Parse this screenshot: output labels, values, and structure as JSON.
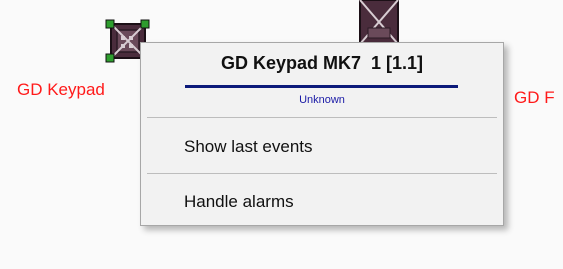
{
  "devices": [
    {
      "label": "GD Keypad",
      "icon": "keypad-device-icon",
      "label_color": "#ff1a1a"
    },
    {
      "label": "GD F",
      "icon": "device-icon",
      "label_color": "#ff1a1a"
    }
  ],
  "context_menu": {
    "title": "GD Keypad MK7  1 [1.1]",
    "subtitle": "Unknown",
    "items": [
      {
        "label": "Show last events"
      },
      {
        "label": "Handle alarms"
      }
    ]
  },
  "colors": {
    "menu_background": "#f2f2f2",
    "title_underline": "#0c1a7a",
    "device_label": "#ff1a1a",
    "selection_handles": "#2e9e2e"
  }
}
